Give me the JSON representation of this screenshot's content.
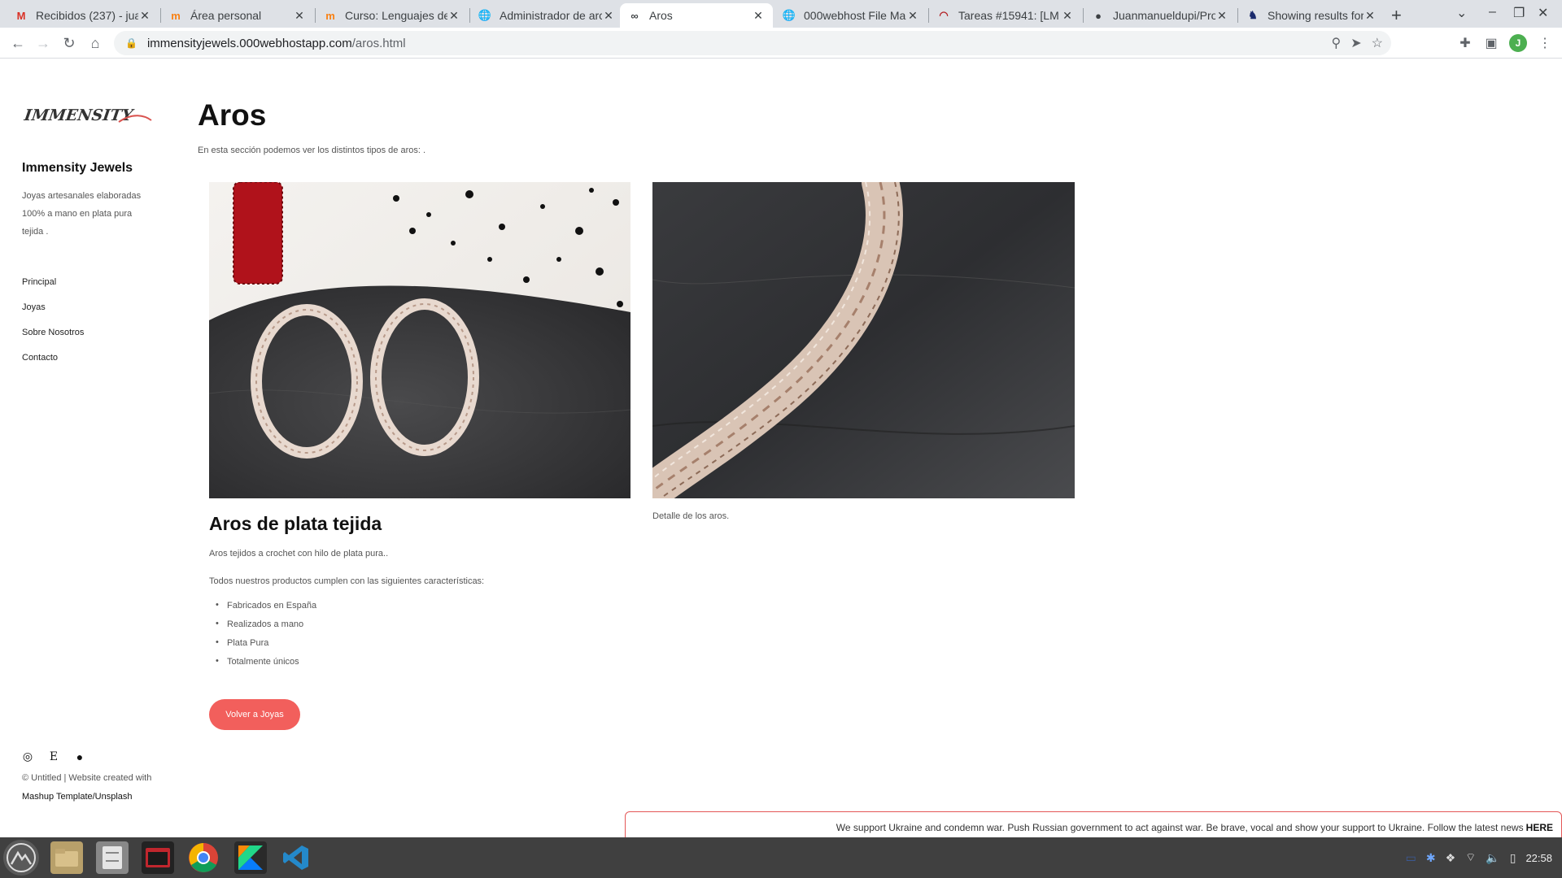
{
  "browser": {
    "tabs": [
      {
        "title": "Recibidos (237) - jua",
        "icon": "gmail-icon"
      },
      {
        "title": "Área personal",
        "icon": "moodle-icon"
      },
      {
        "title": "Curso: Lenguajes de",
        "icon": "moodle-icon"
      },
      {
        "title": "Administrador de arc",
        "icon": "globe-icon"
      },
      {
        "title": "Aros",
        "icon": "link-icon"
      },
      {
        "title": "000webhost File Mar",
        "icon": "globe-icon"
      },
      {
        "title": "Tareas #15941: [LM",
        "icon": "redmine-icon"
      },
      {
        "title": "Juanmanueldupi/Pro",
        "icon": "github-icon"
      },
      {
        "title": "Showing results for",
        "icon": "stackoverflow-icon"
      }
    ],
    "url_host": "immensityjewels.000webhostapp.com",
    "url_path": "/aros.html",
    "profile_initial": "J"
  },
  "sidebar": {
    "logo_text": "IMMENSITY",
    "site_title": "Immensity Jewels",
    "description": "Joyas artesanales elaboradas 100% a mano en plata pura tejida .",
    "nav": [
      "Principal",
      "Joyas",
      "Sobre Nosotros",
      "Contacto"
    ],
    "footer_line1": "© Untitled | Website created with",
    "footer_line2": "Mashup Template/Unsplash"
  },
  "main": {
    "title": "Aros",
    "intro": "En esta sección podemos ver los distintos tipos de aros: .",
    "caption": "Detalle de los aros.",
    "product_title": "Aros de plata tejida",
    "product_desc": "Aros tejidos a crochet con hilo de plata pura..",
    "features_intro": "Todos nuestros productos cumplen con las siguientes características:",
    "features": [
      "Fabricados en España",
      "Realizados a mano",
      "Plata Pura",
      "Totalmente únicos"
    ],
    "back_button": "Volver a Joyas"
  },
  "banner": {
    "text": "We support Ukraine and condemn war. Push Russian government to act against war. Be brave, vocal and show your support to Ukraine. Follow the latest news",
    "link": "HERE"
  },
  "taskbar": {
    "clock": "22:58"
  },
  "colors": {
    "accent": "#f25f5c",
    "chrome_bg": "#dee1e6",
    "taskbar_bg": "#404040"
  }
}
